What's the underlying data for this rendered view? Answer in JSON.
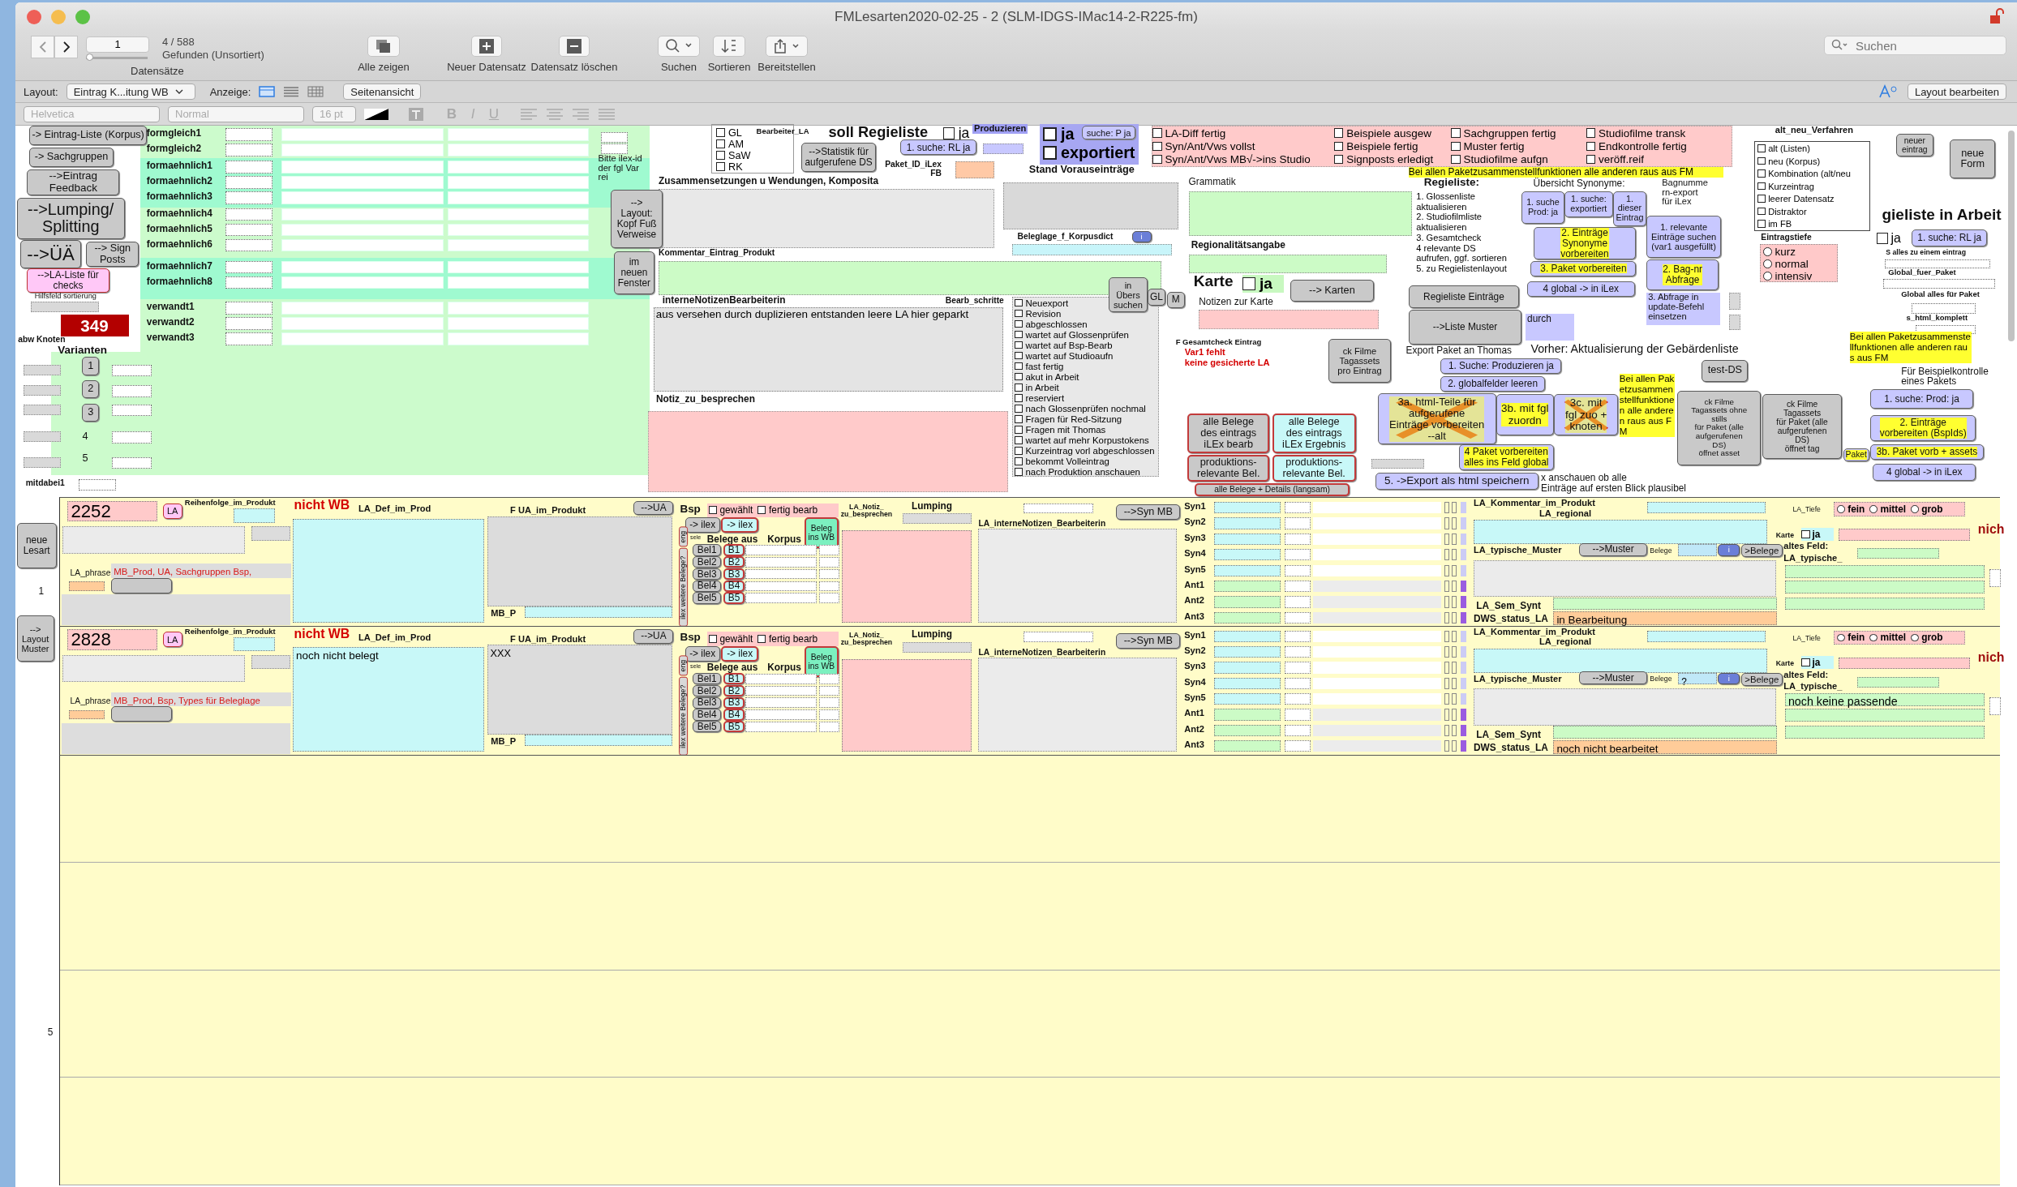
{
  "window": {
    "title": "FMLesarten2020-02-25 - 2 (SLM-IDGS-IMac14-2-R225-fm)"
  },
  "toolbar": {
    "record_number": "1",
    "found": "4 / 588",
    "found_note": "Gefunden (Unsortiert)",
    "records_label": "Datensätze",
    "record_slider": {
      "level": 0
    },
    "actions": [
      {
        "kind": "copy",
        "label": "Alle zeigen"
      },
      {
        "kind": "plus",
        "label": "Neuer Datensatz"
      },
      {
        "kind": "minus",
        "label": "Datensatz löschen"
      },
      {
        "kind": "search",
        "label": "Suchen"
      },
      {
        "kind": "sort",
        "label": "Sortieren"
      },
      {
        "kind": "share",
        "label": "Bereitstellen"
      }
    ],
    "search": {
      "placeholder": "Suchen"
    }
  },
  "layout_bar": {
    "layout_label": "Layout:",
    "layout": "Eintrag K...itung WB",
    "view_label": "Anzeige:",
    "views": [
      {
        "kind": "form",
        "selected": true
      },
      {
        "kind": "list",
        "selected": false
      },
      {
        "kind": "table",
        "selected": false
      }
    ],
    "preview_button": "Seitenansicht",
    "edit_button": "Layout bearbeiten"
  },
  "format_bar": {
    "disabled": true,
    "font": "Helvetica",
    "style": "Normal",
    "size": "16 pt",
    "style_buttons": [
      "B",
      "I",
      "U"
    ]
  },
  "header": {
    "items": [
      {
        "kind": "button",
        "text": "-> Eintrag-Liste (Korpus)"
      },
      {
        "kind": "button",
        "text": "-> Sachgruppen"
      },
      {
        "kind": "button",
        "text": "-->Eintrag\nFeedback"
      },
      {
        "kind": "button",
        "text": "-->Lumping/\nSplitting"
      },
      {
        "kind": "button",
        "text": "-->ÜÄ"
      },
      {
        "kind": "button",
        "text": "--> Sign\nPosts"
      },
      {
        "kind": "button",
        "text": "-->LA-Liste für\nchecks"
      },
      {
        "kind": "label",
        "text": "Hilfsfeld sortierung"
      },
      {
        "kind": "counter",
        "text": "349"
      },
      {
        "kind": "label",
        "text": "abw Knoten"
      },
      {
        "kind": "label",
        "text": "Varianten"
      },
      {
        "kind": "button",
        "text": "1"
      },
      {
        "kind": "button",
        "text": "2"
      },
      {
        "kind": "button",
        "text": "3"
      },
      {
        "kind": "label",
        "text": "4"
      },
      {
        "kind": "label",
        "text": "5"
      },
      {
        "kind": "label",
        "text": "mitdabei1"
      },
      {
        "kind": "label",
        "text": "formgleich1"
      },
      {
        "kind": "label",
        "text": "formgleich2"
      },
      {
        "kind": "label",
        "text": "formaehnlich1"
      },
      {
        "kind": "label",
        "text": "formaehnlich2"
      },
      {
        "kind": "label",
        "text": "formaehnlich3"
      },
      {
        "kind": "label",
        "text": "formaehnlich4"
      },
      {
        "kind": "label",
        "text": "formaehnlich5"
      },
      {
        "kind": "label",
        "text": "formaehnlich6"
      },
      {
        "kind": "label",
        "text": "formaehnlich7"
      },
      {
        "kind": "label",
        "text": "formaehnlich8"
      },
      {
        "kind": "label",
        "text": "verwandt1"
      },
      {
        "kind": "label",
        "text": "verwandt2"
      },
      {
        "kind": "label",
        "text": "verwandt3"
      },
      {
        "kind": "label",
        "text": "Bitte ilex-id\nder fgl Var\nrei"
      },
      {
        "kind": "button",
        "text": "-->\nLayout:\nKopf Fuß\nVerweise"
      },
      {
        "kind": "button",
        "text": "im\nneuen\nFenster"
      },
      {
        "kind": "checklist",
        "items": [
          {
            "label": "GL",
            "checked": false
          },
          {
            "label": "AM",
            "checked": false
          },
          {
            "label": "SaW",
            "checked": false
          },
          {
            "label": "RK",
            "checked": false
          }
        ]
      },
      {
        "kind": "label",
        "text": "Bearbeiter_LA"
      },
      {
        "kind": "label",
        "text": "soll Regieliste"
      },
      {
        "kind": "checkbox",
        "text": "ja",
        "checked": false
      },
      {
        "kind": "label",
        "text": "Produzieren"
      },
      {
        "kind": "button",
        "text": "-->Statistik für\naufgerufene DS"
      },
      {
        "kind": "button",
        "text": "1. suche: RL  ja"
      },
      {
        "kind": "label",
        "text": "Paket_ID_iLex\nFB"
      },
      {
        "kind": "checkbox",
        "text": "ja",
        "checked": false
      },
      {
        "kind": "button",
        "text": "suche: P ja"
      },
      {
        "kind": "checkbox",
        "text": "exportiert",
        "checked": false
      },
      {
        "kind": "label",
        "text": "Stand Vorauseinträge"
      },
      {
        "kind": "label",
        "text": "Beleglage_f_Korpusdict"
      },
      {
        "kind": "button",
        "text": "i"
      },
      {
        "kind": "label",
        "text": "Zusammensetzungen u Wendungen, Komposita"
      },
      {
        "kind": "label",
        "text": "Kommentar_Eintrag_Produkt"
      },
      {
        "kind": "label",
        "text": "interneNotizenBearbeiterin"
      },
      {
        "kind": "label",
        "text": "Bearb_schritte"
      },
      {
        "kind": "button",
        "text": "in\nÜbers\nsuchen"
      },
      {
        "kind": "button",
        "text": "GL"
      },
      {
        "kind": "button",
        "text": "M"
      },
      {
        "kind": "textfield",
        "text": "aus versehen durch duplizieren entstanden leere LA hier geparkt"
      },
      {
        "kind": "checklist",
        "items": [
          {
            "label": "Neuexport",
            "checked": false
          },
          {
            "label": "Revision",
            "checked": false
          },
          {
            "label": "abgeschlossen",
            "checked": false
          },
          {
            "label": "wartet auf Glossenprüfen",
            "checked": false
          },
          {
            "label": "wartet auf Bsp-Bearb",
            "checked": false
          },
          {
            "label": "wartet auf Studioaufn",
            "checked": false
          },
          {
            "label": "fast fertig",
            "checked": false
          },
          {
            "label": "akut in Arbeit",
            "checked": false
          },
          {
            "label": "in Arbeit",
            "checked": false
          },
          {
            "label": "reserviert",
            "checked": false
          },
          {
            "label": "nach Glossenprüfen nochmal",
            "checked": false
          },
          {
            "label": "Fragen für Red-Sitzung",
            "checked": false
          },
          {
            "label": "Fragen mit Thomas",
            "checked": false
          },
          {
            "label": "wartet auf mehr Korpustokens",
            "checked": false
          },
          {
            "label": "Kurzeintrag vorl abgeschlossen",
            "checked": false
          },
          {
            "label": "bekommt Volleintrag",
            "checked": false
          },
          {
            "label": "nach Produktion anschauen",
            "checked": false
          }
        ]
      },
      {
        "kind": "label",
        "text": "Notiz_zu_besprechen"
      },
      {
        "kind": "checklist",
        "items": [
          {
            "label": "LA-Diff fertig",
            "checked": false
          },
          {
            "label": "Syn/Ant/Vws vollst",
            "checked": false
          },
          {
            "label": "Syn/Ant/Vws MB√->ins Studio",
            "checked": false
          }
        ]
      },
      {
        "kind": "checklist",
        "items": [
          {
            "label": "Beispiele ausgew",
            "checked": false
          },
          {
            "label": "Beispiele fertig",
            "checked": false
          },
          {
            "label": "Signposts erledigt",
            "checked": false
          }
        ]
      },
      {
        "kind": "checklist",
        "items": [
          {
            "label": "Sachgruppen fertig",
            "checked": false
          },
          {
            "label": "Muster fertig",
            "checked": false
          },
          {
            "label": "Studiofilme aufgn",
            "checked": false
          }
        ]
      },
      {
        "kind": "checklist",
        "items": [
          {
            "label": "Studiofilme transk",
            "checked": false
          },
          {
            "label": "Endkontrolle fertig",
            "checked": false
          },
          {
            "label": "veröff.reif",
            "checked": false
          }
        ]
      },
      {
        "kind": "note",
        "text": "Bei allen Paketzusammenstellfunktionen alle anderen raus aus FM"
      },
      {
        "kind": "label",
        "text": "Grammatik"
      },
      {
        "kind": "label",
        "text": "Regionalitätsangabe"
      },
      {
        "kind": "label",
        "text": "Karte"
      },
      {
        "kind": "checkbox",
        "text": "ja",
        "checked": false
      },
      {
        "kind": "button",
        "text": "--> Karten"
      },
      {
        "kind": "label",
        "text": "Notizen zur Karte"
      },
      {
        "kind": "label",
        "text": "F Gesamtcheck Eintrag"
      },
      {
        "kind": "label",
        "text": "Var1 fehlt"
      },
      {
        "kind": "label",
        "text": "keine gesicherte LA"
      },
      {
        "kind": "button",
        "text": "ck Filme\nTagassets\npro Eintrag"
      },
      {
        "kind": "button",
        "text": "alle Belege\ndes eintrags\niLEx bearb"
      },
      {
        "kind": "button",
        "text": "alle Belege\ndes eintrags\niLEx Ergebnis"
      },
      {
        "kind": "button",
        "text": "produktions-\nrelevante Bel."
      },
      {
        "kind": "button",
        "text": "produktions-\nrelevante Bel."
      },
      {
        "kind": "button",
        "text": "alle Belege + Details (langsam)"
      },
      {
        "kind": "label",
        "text": "Regieliste:"
      },
      {
        "kind": "paragraph",
        "text": "1. Glossenliste\naktualisieren\n2. Studiofilmliste\naktualisieren\n3. Gesamtcheck\n4 relevante DS\naufrufen, ggf. sortieren\n5. zu Regielistenlayout"
      },
      {
        "kind": "label",
        "text": "Übersicht Synonyme:"
      },
      {
        "kind": "button",
        "text": "1. suche\nProd: ja"
      },
      {
        "kind": "button",
        "text": "1. suche:\nexportiert"
      },
      {
        "kind": "button",
        "text": "1.\ndieser\nEintrag"
      },
      {
        "kind": "button",
        "text": "2. Einträge\nSynonyme\nvorbereiten"
      },
      {
        "kind": "button",
        "text": "3. Paket vorbereiten"
      },
      {
        "kind": "button",
        "text": "4 global ->  in iLex"
      },
      {
        "kind": "label",
        "text": "Bagnumme\nrn-export\nfür iLex"
      },
      {
        "kind": "button",
        "text": "1. relevante\nEinträge suchen\n(var1 ausgefüllt)"
      },
      {
        "kind": "button",
        "text": "2. Bag-nr\nAbfrage"
      },
      {
        "kind": "button",
        "text": "Regieliste Einträge"
      },
      {
        "kind": "label",
        "text": "3. Abfrage in\nupdate-Befehl\neinsetzen"
      },
      {
        "kind": "button",
        "text": "-->Liste Muster"
      },
      {
        "kind": "label",
        "text": "durch"
      },
      {
        "kind": "label",
        "text": "Export Paket an Thomas"
      },
      {
        "kind": "label",
        "text": "Vorher: Aktualisierung der Gebärdenliste"
      },
      {
        "kind": "button",
        "text": "1. Suche: Produzieren ja"
      },
      {
        "kind": "button",
        "text": "2. globalfelder leeren"
      },
      {
        "kind": "button",
        "text": "3a. html-Teile für\naufgerufene\nEinträge vorbereiten\n--alt",
        "crossed": true
      },
      {
        "kind": "button",
        "text": "3b.  mit fgl\nzuordn",
        "crossed": false
      },
      {
        "kind": "button",
        "text": "3c. mit\nfgl zuo +\nknoten",
        "crossed": true
      },
      {
        "kind": "note",
        "text": "Bei allen Paketzusammenstellfunktionen alle anderen raus aus FM"
      },
      {
        "kind": "button",
        "text": "4 Paket vorbereiten\nalles ins Feld global"
      },
      {
        "kind": "button",
        "text": "5. ->Export als html speichern"
      },
      {
        "kind": "label",
        "text": "x anschauen ob alle\nEinträge auf ersten Blick plausibel"
      },
      {
        "kind": "button",
        "text": "test-DS"
      },
      {
        "kind": "button",
        "text": "ck Filme\nTagassets ohne\nstills\nfür Paket (alle\naufgerufenen\nDS)\nöffnet asset"
      },
      {
        "kind": "button",
        "text": "ck Filme\nTagassets\nfür Paket (alle\naufgerufenen\nDS)\nöffnet tag"
      },
      {
        "kind": "note",
        "text": "Bei allen Paketzusammenstellfunktionen alle anderen raus aus FM"
      },
      {
        "kind": "label",
        "text": "Für Beispielkontrolle\neines Pakets"
      },
      {
        "kind": "button",
        "text": "1. suche: Prod: ja"
      },
      {
        "kind": "button",
        "text": "2. Einträge\nvorbereiten (BspIds)"
      },
      {
        "kind": "button",
        "text": "Paket"
      },
      {
        "kind": "button",
        "text": "3b. Paket vorb + assets"
      },
      {
        "kind": "button",
        "text": "4 global ->  in iLex"
      },
      {
        "kind": "label",
        "text": "alt_neu_Verfahren"
      },
      {
        "kind": "checklist",
        "items": [
          {
            "label": "alt (Listen)",
            "checked": false
          },
          {
            "label": "neu (Korpus)",
            "checked": false
          },
          {
            "label": "Kombination (alt/neu",
            "checked": false
          },
          {
            "label": "Kurzeintrag",
            "checked": false
          },
          {
            "label": "leerer Datensatz",
            "checked": false
          },
          {
            "label": "Distraktor",
            "checked": false
          },
          {
            "label": "im FB",
            "checked": false
          }
        ]
      },
      {
        "kind": "button",
        "text": "neuer\neintrag"
      },
      {
        "kind": "button",
        "text": "neue\nForm"
      },
      {
        "kind": "label",
        "text": "gieliste in Arbeit"
      },
      {
        "kind": "label",
        "text": "Eintragstiefe"
      },
      {
        "kind": "radiolist",
        "items": [
          {
            "label": "kurz",
            "selected": false
          },
          {
            "label": "normal",
            "selected": false
          },
          {
            "label": "intensiv",
            "selected": false
          }
        ]
      },
      {
        "kind": "checkbox",
        "text": "ja",
        "checked": false
      },
      {
        "kind": "button",
        "text": "1. suche: RL  ja"
      },
      {
        "kind": "label",
        "text": "S alles zu einem eintrag"
      },
      {
        "kind": "label",
        "text": "Global_fuer_Paket"
      },
      {
        "kind": "label",
        "text": "Global alles für Paket"
      },
      {
        "kind": "label",
        "text": "s_html_komplett"
      }
    ]
  },
  "side": {
    "new_button": "neue\nLesart",
    "first_index": "1",
    "layout_button": "-->\nLayout\nMuster",
    "last_index": "5"
  },
  "records": [
    {
      "number": "2252",
      "la_button": "LA",
      "order_label": "Reihenfolge_im_Produkt",
      "phrase_label": "LA_phrase",
      "phrase": "MB_Prod, UA, Sachgruppen Bsp,",
      "wb_flag": "nicht WB",
      "def_label": "LA_Def_im_Prod",
      "ua_label": "F UA_im_Produkt",
      "mbp_label": "MB_P",
      "ua_button": "-->UA",
      "bsp_label": "Bsp",
      "bsp_checks": [
        {
          "label": "gewählt",
          "checked": false
        },
        {
          "label": "fertig bearb",
          "checked": false
        }
      ],
      "ilex_buttons": [
        "-> ilex",
        "-> ilex"
      ],
      "beleg_button": "Beleg\nins WB",
      "eng_tag": "eng",
      "more_tag": "ilex weitere Belege?",
      "sele_label": "sele",
      "belege_label": "Belege aus",
      "korpus_label": "Korpus",
      "bel_buttons": [
        "Bel1",
        "Bel2",
        "Bel3",
        "Bel4",
        "Bel5"
      ],
      "b_buttons": [
        "B1",
        "B2",
        "B3",
        "B4",
        "B5"
      ],
      "notiz_label": "LA_Notiz_\nzu_besprechen",
      "lumping_label": "Lumping",
      "syn_button": "-->Syn MB",
      "notes_label": "LA_interneNotizen_Bearbeiterin",
      "syn_labels": [
        "Syn1",
        "Syn2",
        "Syn3",
        "Syn4",
        "Syn5",
        "Ant1",
        "Ant2",
        "Ant3"
      ],
      "kommentar_label": "LA_Kommentar_im_Produkt",
      "regional_label": "LA_regional",
      "muster_label": "LA_typische_Muster",
      "muster_button": "-->Muster",
      "belege_small": "Belege",
      "info_button": "i",
      "belege_button": ">Belege",
      "sem_label": "LA_Sem_Synt",
      "status_label": "DWS_status_LA",
      "status": "in Bearbeitung",
      "tiefe_label": "LA_Tiefe",
      "tiefe": [
        {
          "label": "fein",
          "selected": false
        },
        {
          "label": "mittel",
          "selected": false
        },
        {
          "label": "grob",
          "selected": false
        }
      ],
      "karte_label": "Karte",
      "karte_check": {
        "label": "ja",
        "checked": false
      },
      "cut_flag": "nich",
      "altes_label": "altes Feld:",
      "typ_label": "LA_typische_"
    },
    {
      "number": "2828",
      "la_button": "LA",
      "order_label": "Reihenfolge_im_Produkt",
      "phrase_label": "LA_phrase",
      "phrase": "MB_Prod, Bsp, Types für Beleglage",
      "wb_flag": "nicht WB",
      "def_label": "LA_Def_im_Prod",
      "definition": "noch nicht belegt",
      "ua_label": "F UA_im_Produkt",
      "ua_text": "XXX",
      "mbp_label": "MB_P",
      "ua_button": "-->UA",
      "bsp_label": "Bsp",
      "bsp_checks": [
        {
          "label": "gewählt",
          "checked": false
        },
        {
          "label": "fertig bearb",
          "checked": false
        }
      ],
      "ilex_buttons": [
        "-> ilex",
        "-> ilex"
      ],
      "beleg_button": "Beleg\nins WB",
      "eng_tag": "eng",
      "more_tag": "ilex weitere Belege?",
      "sele_label": "sele",
      "belege_label": "Belege aus",
      "korpus_label": "Korpus",
      "bel_buttons": [
        "Bel1",
        "Bel2",
        "Bel3",
        "Bel4",
        "Bel5"
      ],
      "b_buttons": [
        "B1",
        "B2",
        "B3",
        "B4",
        "B5"
      ],
      "notiz_label": "LA_Notiz_\nzu_besprechen",
      "lumping_label": "Lumping",
      "syn_button": "-->Syn MB",
      "notes_label": "LA_interneNotizen_Bearbeiterin",
      "syn_labels": [
        "Syn1",
        "Syn2",
        "Syn3",
        "Syn4",
        "Syn5",
        "Ant1",
        "Ant2",
        "Ant3"
      ],
      "kommentar_label": "LA_Kommentar_im_Produkt",
      "regional_label": "LA_regional",
      "muster_label": "LA_typische_Muster",
      "muster_button": "-->Muster",
      "belege_small": "Belege",
      "belege_value": "?",
      "info_button": "i",
      "belege_button": ">Belege",
      "sem_label": "LA_Sem_Synt",
      "status_label": "DWS_status_LA",
      "status": "noch nicht bearbeitet",
      "tiefe_label": "LA_Tiefe",
      "tiefe": [
        {
          "label": "fein",
          "selected": false
        },
        {
          "label": "mittel",
          "selected": false
        },
        {
          "label": "grob",
          "selected": false
        }
      ],
      "karte_label": "Karte",
      "karte_check": {
        "label": "ja",
        "checked": false
      },
      "cut_flag": "nich",
      "altes_label": "altes Feld:",
      "typ_label": "LA_typische_",
      "pattern_value": "noch keine passende"
    }
  ]
}
